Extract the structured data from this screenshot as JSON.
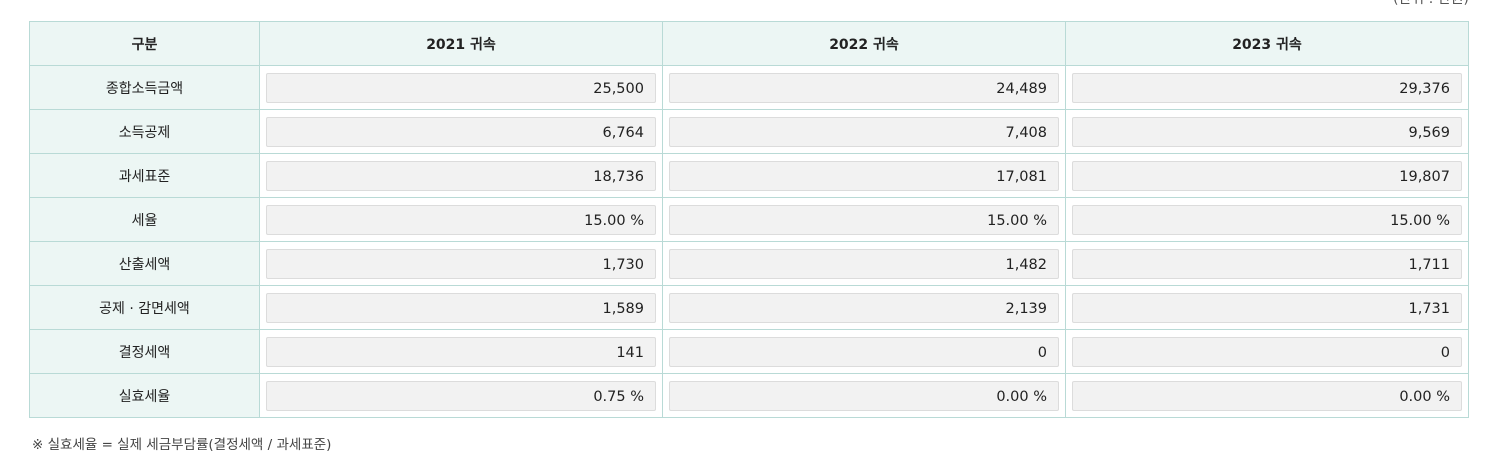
{
  "unit_note": "(단위 : 만원)",
  "table": {
    "headers": [
      "구분",
      "2021 귀속",
      "2022 귀속",
      "2023 귀속"
    ],
    "rows": [
      {
        "label": "종합소득금액",
        "values": [
          "25,500",
          "24,489",
          "29,376"
        ]
      },
      {
        "label": "소득공제",
        "values": [
          "6,764",
          "7,408",
          "9,569"
        ]
      },
      {
        "label": "과세표준",
        "values": [
          "18,736",
          "17,081",
          "19,807"
        ]
      },
      {
        "label": "세율",
        "values": [
          "15.00 %",
          "15.00 %",
          "15.00 %"
        ]
      },
      {
        "label": "산출세액",
        "values": [
          "1,730",
          "1,482",
          "1,711"
        ]
      },
      {
        "label": "공제 · 감면세액",
        "values": [
          "1,589",
          "2,139",
          "1,731"
        ]
      },
      {
        "label": "결정세액",
        "values": [
          "141",
          "0",
          "0"
        ]
      },
      {
        "label": "실효세율",
        "values": [
          "0.75 %",
          "0.00 %",
          "0.00 %"
        ]
      }
    ]
  },
  "footnote": "※ 실효세율 = 실제 세금부담률(결정세액 / 과세표준)"
}
